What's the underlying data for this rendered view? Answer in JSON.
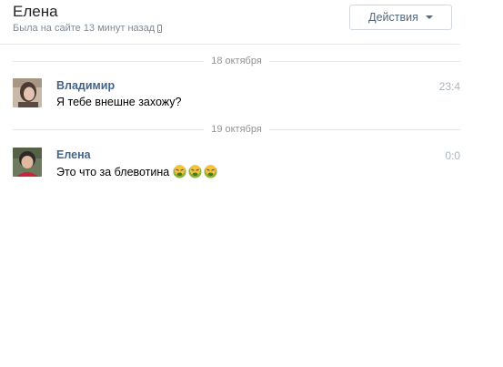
{
  "header": {
    "contact_name": "Елена",
    "status": "Была на сайте 13 минут назад",
    "actions_label": "Действия"
  },
  "separators": [
    "18 октября",
    "19 октября"
  ],
  "messages": [
    {
      "sender": "Владимир",
      "time": "23:4",
      "text": "Я тебе внешне захожу?"
    },
    {
      "sender": "Елена",
      "time": "0:0",
      "text": "Это что за блевотина",
      "emoji": [
        "nauseated-face",
        "nauseated-face",
        "nauseated-face"
      ]
    }
  ]
}
